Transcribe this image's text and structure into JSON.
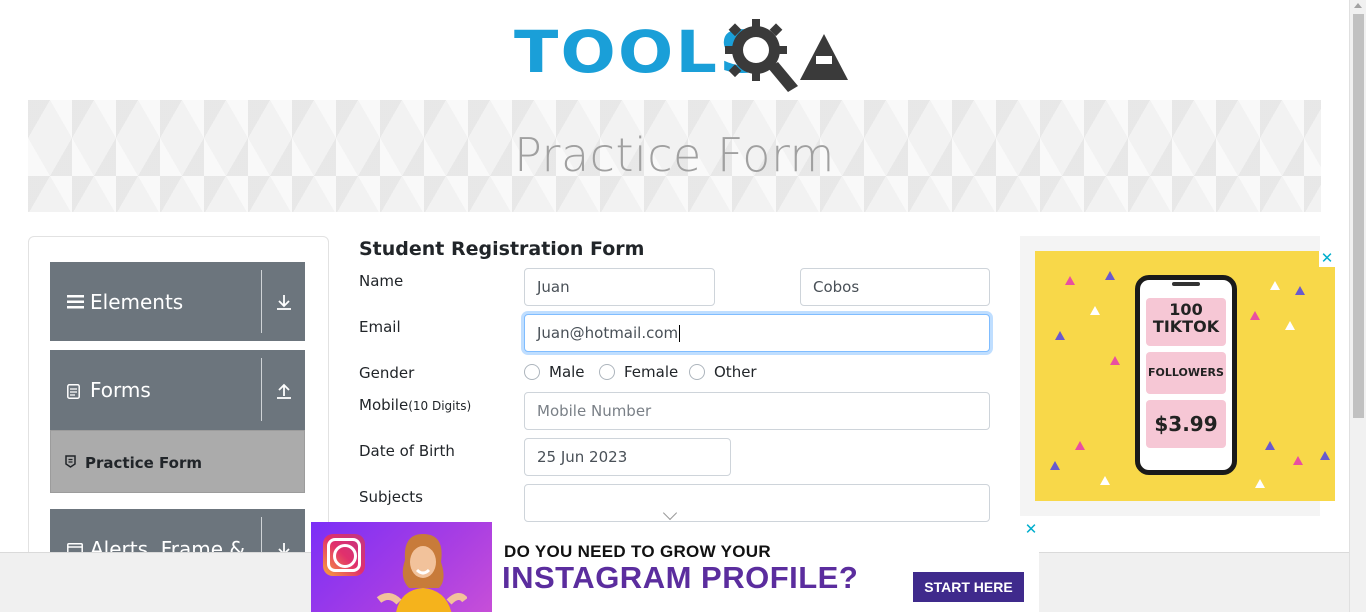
{
  "header": {
    "logo_text": "TOOLS",
    "logo_alt": "TOOLSQA"
  },
  "banner": {
    "title": "Practice Form"
  },
  "sidebar": {
    "groups": [
      {
        "label": "Elements",
        "icon": "hamburger-icon",
        "arrow": "download-arrow-icon"
      },
      {
        "label": "Forms",
        "icon": "document-icon",
        "arrow": "upload-arrow-icon"
      },
      {
        "label": "Alerts, Frame &",
        "icon": "window-icon",
        "arrow": "download-arrow-icon"
      }
    ],
    "active_item": {
      "label": "Practice Form",
      "icon": "badge-icon"
    }
  },
  "form": {
    "title": "Student Registration Form",
    "name_label": "Name",
    "first_name": "Juan",
    "last_name": "Cobos",
    "email_label": "Email",
    "email_value": "Juan@hotmail.com",
    "gender_label": "Gender",
    "gender_options": [
      "Male",
      "Female",
      "Other"
    ],
    "mobile_label": "Mobile",
    "mobile_hint": "(10 Digits)",
    "mobile_placeholder": "Mobile Number",
    "dob_label": "Date of Birth",
    "dob_value": "25 Jun 2023",
    "subjects_label": "Subjects"
  },
  "ad_right": {
    "line1": "100",
    "line2": "TIKTOK",
    "line3": "FOLLOWERS",
    "price": "$3.99",
    "close": "✕"
  },
  "ad_bottom": {
    "headline1": "DO YOU NEED TO GROW YOUR",
    "headline2": "INSTAGRAM PROFILE?",
    "cta": "START HERE",
    "close": "✕"
  },
  "colors": {
    "brand_blue": "#1a9fd8",
    "sidebar_gray": "#6c757d",
    "ad_yellow": "#f8d849",
    "ad_purple": "#5b2d9e"
  }
}
